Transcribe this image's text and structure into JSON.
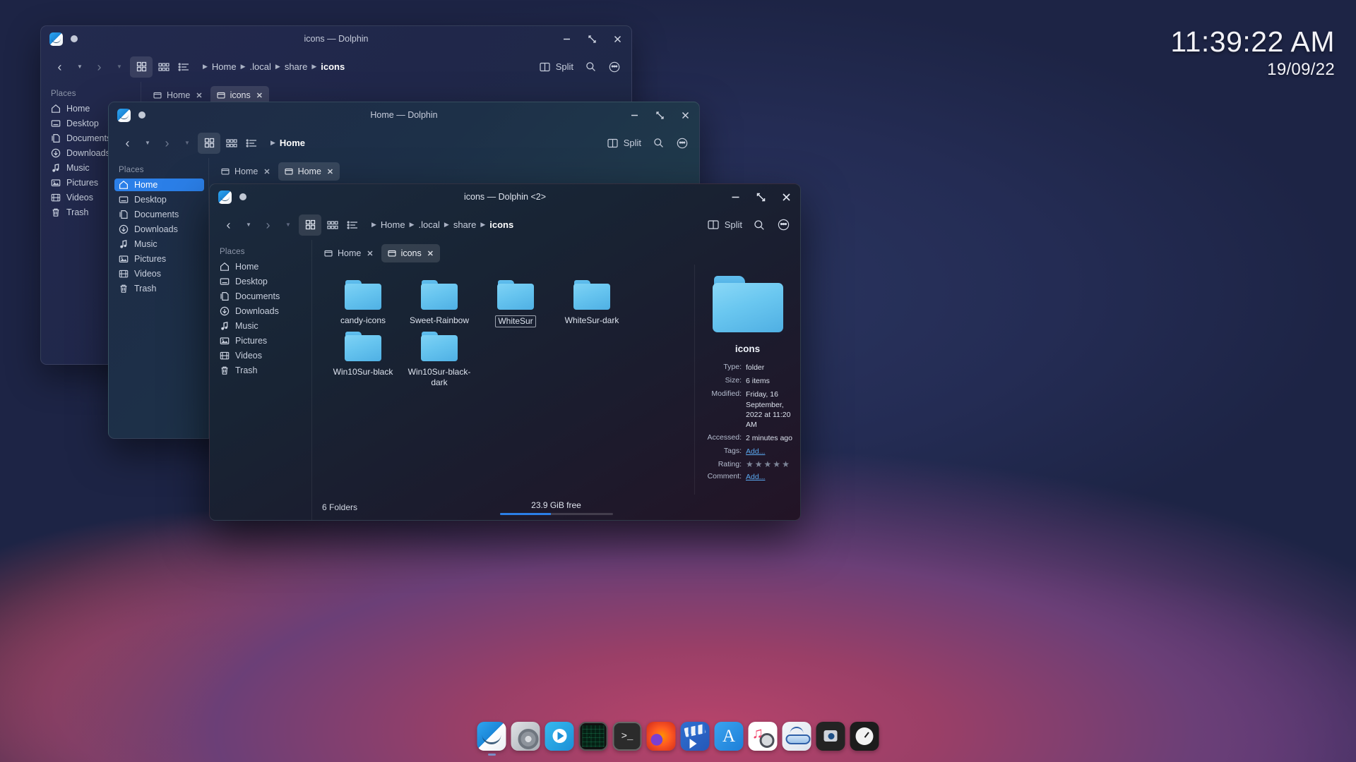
{
  "clock": {
    "time": "11:39:22 AM",
    "date": "19/09/22"
  },
  "windows": [
    {
      "title": "icons — Dolphin",
      "breadcrumbs": [
        "Home",
        ".local",
        "share",
        "icons"
      ],
      "split_label": "Split",
      "places_header": "Places",
      "places": [
        "Home",
        "Desktop",
        "Documents",
        "Downloads",
        "Music",
        "Pictures",
        "Videos",
        "Trash"
      ],
      "selected_place": "",
      "tabs": [
        {
          "label": "Home",
          "close": "✕",
          "selected": false
        },
        {
          "label": "icons",
          "close": "✕",
          "selected": true
        }
      ]
    },
    {
      "title": "Home — Dolphin",
      "breadcrumbs": [
        "Home"
      ],
      "split_label": "Split",
      "places_header": "Places",
      "places": [
        "Home",
        "Desktop",
        "Documents",
        "Downloads",
        "Music",
        "Pictures",
        "Videos",
        "Trash"
      ],
      "selected_place": "Home",
      "tabs": [
        {
          "label": "Home",
          "close": "✕",
          "selected": false
        },
        {
          "label": "Home",
          "close": "✕",
          "selected": true
        }
      ]
    },
    {
      "title": "icons — Dolphin <2>",
      "breadcrumbs": [
        "Home",
        ".local",
        "share",
        "icons"
      ],
      "split_label": "Split",
      "places_header": "Places",
      "places": [
        "Home",
        "Desktop",
        "Documents",
        "Downloads",
        "Music",
        "Pictures",
        "Videos",
        "Trash"
      ],
      "selected_place": "",
      "tabs": [
        {
          "label": "Home",
          "close": "✕",
          "selected": false
        },
        {
          "label": "icons",
          "close": "✕",
          "selected": true
        }
      ],
      "folders": [
        {
          "name": "candy-icons",
          "focused": false
        },
        {
          "name": "Sweet-Rainbow",
          "focused": false
        },
        {
          "name": "WhiteSur",
          "focused": true
        },
        {
          "name": "WhiteSur-dark",
          "focused": false
        },
        {
          "name": "Win10Sur-black",
          "focused": false
        },
        {
          "name": "Win10Sur-black-dark",
          "focused": false
        }
      ],
      "info": {
        "name": "icons",
        "rows": [
          {
            "key": "Type:",
            "value": "folder",
            "link": false
          },
          {
            "key": "Size:",
            "value": "6 items",
            "link": false
          },
          {
            "key": "Modified:",
            "value": "Friday, 16 September, 2022 at 11:20 AM",
            "link": false
          },
          {
            "key": "Accessed:",
            "value": "2 minutes ago",
            "link": false
          },
          {
            "key": "Tags:",
            "value": "Add...",
            "link": true
          }
        ],
        "rating_key": "Rating:",
        "rating_stars": 5,
        "rating_filled": 0,
        "comment_key": "Comment:",
        "comment_value": "Add..."
      },
      "status": {
        "count": "6 Folders",
        "free": "23.9 GiB free",
        "free_percent": 45
      }
    }
  ],
  "window_controls": {
    "minimize": "minimize-icon",
    "maximize": "maximize-icon",
    "close": "close-icon"
  },
  "dock": [
    {
      "name": "finder",
      "running": true
    },
    {
      "name": "system-settings",
      "running": false
    },
    {
      "name": "media-player",
      "running": false
    },
    {
      "name": "system-monitor",
      "running": false
    },
    {
      "name": "terminal",
      "running": false
    },
    {
      "name": "firefox",
      "running": false
    },
    {
      "name": "kdenlive",
      "running": false
    },
    {
      "name": "app-store",
      "running": false
    },
    {
      "name": "music",
      "running": false
    },
    {
      "name": "spectacle-glasses",
      "running": false
    },
    {
      "name": "screenshot",
      "running": false
    },
    {
      "name": "clock",
      "running": false
    }
  ],
  "colors": {
    "accent": "#2b7fe8",
    "folder": "#6ac7f0",
    "link": "#5aa9f0"
  }
}
